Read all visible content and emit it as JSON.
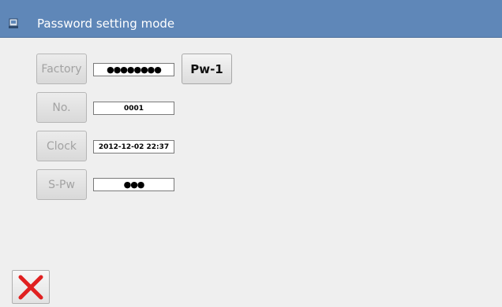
{
  "window": {
    "title": "Password setting mode",
    "icon": "device-icon"
  },
  "rows": [
    {
      "label": "Factory",
      "value": "●●●●●●●●",
      "value_kind": "masked"
    },
    {
      "label": "No.",
      "value": "0001",
      "value_kind": "text"
    },
    {
      "label": "Clock",
      "value": "2012-12-02 22:37",
      "value_kind": "text"
    },
    {
      "label": "S-Pw",
      "value": "●●●",
      "value_kind": "masked"
    }
  ],
  "pw_button": {
    "label": "Pw-1"
  },
  "close_button": {
    "icon": "close-icon",
    "color": "#e02020"
  },
  "colors": {
    "titlebar": "#5f87b8",
    "background": "#efefef",
    "disabled_text": "#a2a2a2"
  }
}
